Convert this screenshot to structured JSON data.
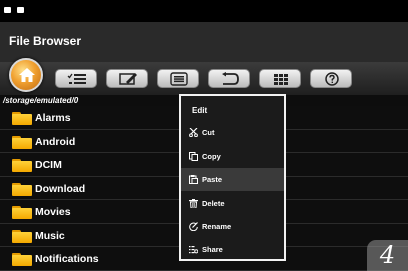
{
  "app": {
    "title": "File Browser"
  },
  "toolbar": {
    "buttons": [
      {
        "icon": "home-icon"
      },
      {
        "icon": "list-view-icon"
      },
      {
        "icon": "edit-icon"
      },
      {
        "icon": "menu-icon"
      },
      {
        "icon": "back-icon"
      },
      {
        "icon": "grid-view-icon"
      },
      {
        "icon": "help-icon"
      }
    ]
  },
  "path": "/storage/emulated/0",
  "files": [
    {
      "name": "Alarms"
    },
    {
      "name": "Android"
    },
    {
      "name": "DCIM"
    },
    {
      "name": "Download"
    },
    {
      "name": "Movies"
    },
    {
      "name": "Music"
    },
    {
      "name": "Notifications"
    }
  ],
  "edit_menu": {
    "title": "Edit",
    "items": [
      {
        "label": "Cut",
        "icon": "scissors-icon"
      },
      {
        "label": "Copy",
        "icon": "copy-icon"
      },
      {
        "label": "Paste",
        "icon": "paste-icon",
        "highlighted": true
      },
      {
        "label": "Delete",
        "icon": "trash-icon"
      },
      {
        "label": "Rename",
        "icon": "rename-icon"
      },
      {
        "label": "Share",
        "icon": "share-icon"
      }
    ]
  },
  "page_indicator": "4",
  "colors": {
    "folder": "#f4b400",
    "accent": "#f0a030",
    "highlight": "#3a3a3a"
  }
}
